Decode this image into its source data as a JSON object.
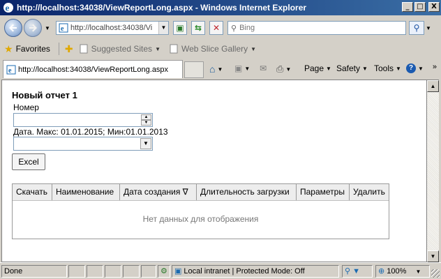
{
  "window": {
    "title": "http://localhost:34038/ViewReportLong.aspx - Windows Internet Explorer",
    "buttons": {
      "minimize": "_",
      "maximize": "□",
      "close": "X"
    }
  },
  "address_bar": {
    "url": "http://localhost:34038/Vi",
    "search_placeholder": "Bing"
  },
  "favorites_bar": {
    "favorites_label": "Favorites",
    "items": [
      "Suggested Sites",
      "Web Slice Gallery"
    ]
  },
  "tabs": [
    {
      "title": "http://localhost:34038/ViewReportLong.aspx"
    }
  ],
  "command_bar": {
    "page": "Page",
    "safety": "Safety",
    "tools": "Tools"
  },
  "page": {
    "report_title": "Новый отчет 1",
    "number_label": "Номер",
    "number_value": "",
    "date_label": "Дата. Макс: 01.01.2015; Мин:01.01.2013",
    "date_value": "",
    "excel_button": "Excel",
    "grid": {
      "columns": [
        "Скачать",
        "Наименование",
        "Дата создания ∇",
        "Длительность загрузки",
        "Параметры",
        "Удалить"
      ],
      "empty_text": "Нет данных для отображения"
    }
  },
  "status_bar": {
    "status": "Done",
    "zone": "Local intranet | Protected Mode: Off",
    "zoom": "100%"
  }
}
